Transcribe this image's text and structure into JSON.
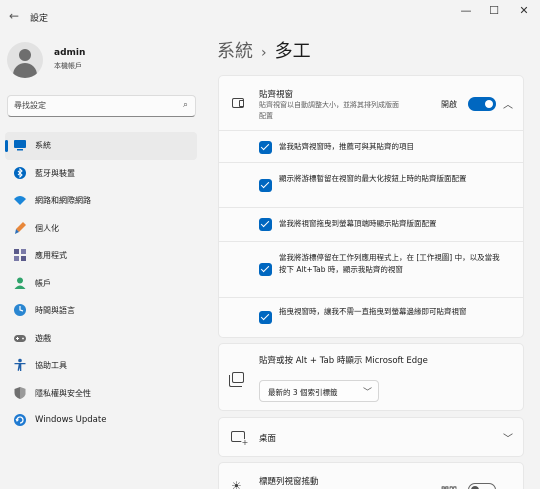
{
  "window": {
    "title": "設定",
    "back_glyph": "←",
    "minimize_glyph": "—",
    "maximize_glyph": "☐",
    "close_glyph": "✕"
  },
  "user": {
    "name": "admin",
    "account_type": "本機帳戶"
  },
  "search": {
    "placeholder": "尋找設定"
  },
  "sidebar": {
    "items": [
      {
        "label": "系統",
        "icon": "monitor-icon",
        "active": true
      },
      {
        "label": "藍牙與裝置",
        "icon": "bluetooth-icon"
      },
      {
        "label": "網路和網際網路",
        "icon": "wifi-icon"
      },
      {
        "label": "個人化",
        "icon": "brush-icon"
      },
      {
        "label": "應用程式",
        "icon": "apps-icon"
      },
      {
        "label": "帳戶",
        "icon": "account-icon"
      },
      {
        "label": "時間與語言",
        "icon": "globe-clock-icon"
      },
      {
        "label": "遊戲",
        "icon": "gamepad-icon"
      },
      {
        "label": "協助工具",
        "icon": "accessibility-icon"
      },
      {
        "label": "隱私權與安全性",
        "icon": "shield-icon"
      },
      {
        "label": "Windows Update",
        "icon": "update-icon"
      }
    ]
  },
  "breadcrumb": {
    "parent": "系統",
    "separator": "›",
    "current": "多工"
  },
  "snap": {
    "title": "貼齊視窗",
    "description": "貼齊視窗以自動調整大小，並將其排列成版面配置",
    "toggle_label": "開啟",
    "toggle_on": true,
    "options": [
      {
        "text": "當我貼齊視窗時，推薦可與其貼齊的項目",
        "checked": true
      },
      {
        "text": "顯示將游標暫留在視窗的最大化按鈕上時的貼齊版面配置",
        "checked": true
      },
      {
        "text": "當我將視窗拖曳到螢幕頂端時顯示貼齊版面配置",
        "checked": true
      },
      {
        "text": "當我將游標停留在工作列應用程式上，在 [工作視圖] 中，以及當我按下 Alt+Tab 時，顯示我貼齊的視窗",
        "checked": true
      },
      {
        "text": "拖曳視窗時，讓我不需一直拖曳到螢幕邊緣即可貼齊視窗",
        "checked": true
      }
    ]
  },
  "alt_tab": {
    "title": "貼齊或按 Alt + Tab 時顯示 Microsoft Edge",
    "selected": "最新的 3 個索引標籤"
  },
  "desktops": {
    "title": "桌面"
  },
  "title_bar_shake": {
    "title": "標題列視窗搖動",
    "toggle_label": "關閉",
    "toggle_on": false
  },
  "colors": {
    "accent": "#0067c0",
    "background": "#f3f3f3",
    "card": "#fbfbfb"
  }
}
